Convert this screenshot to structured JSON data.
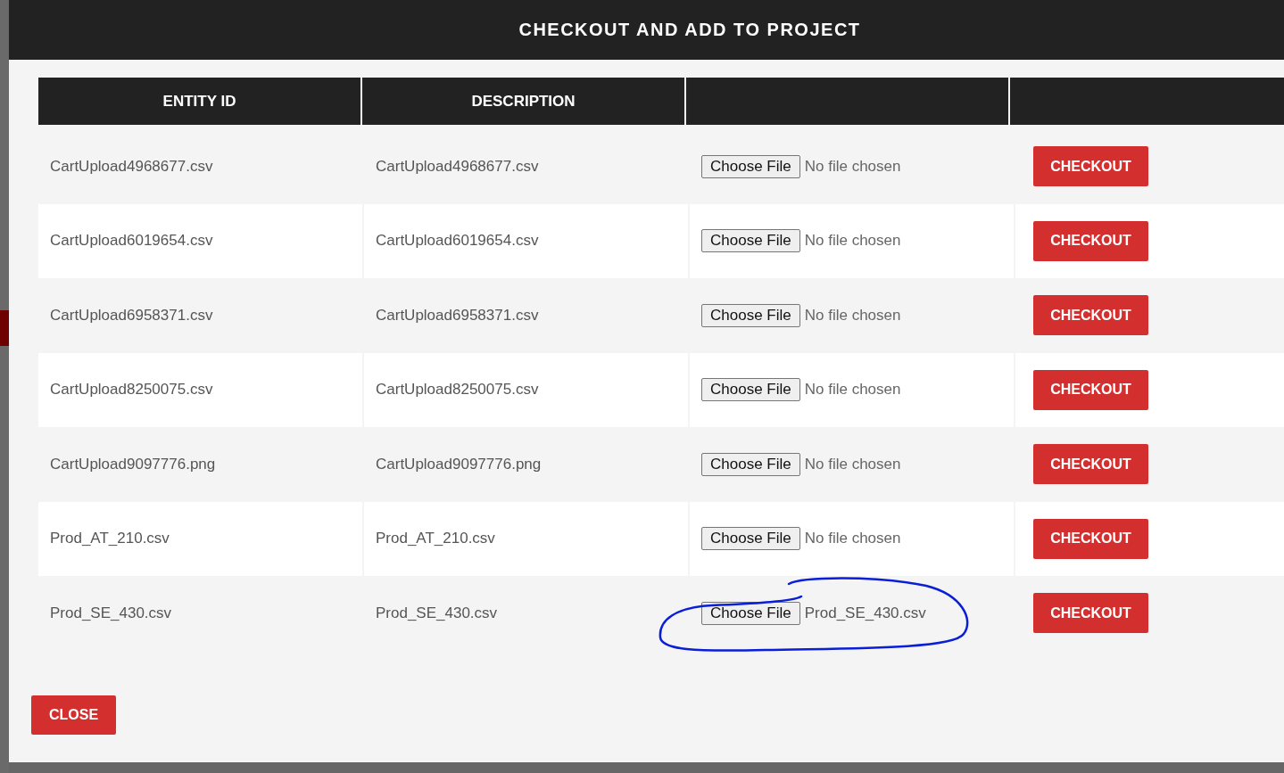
{
  "modal": {
    "title": "CHECKOUT AND ADD TO PROJECT"
  },
  "table": {
    "columns": [
      "ENTITY ID",
      "DESCRIPTION"
    ],
    "rows": [
      {
        "entity_id": "CartUpload4968677.csv",
        "description": "CartUpload4968677.csv",
        "file_button": "Choose File",
        "file_status": "No file chosen",
        "file_chosen": false,
        "checkout": "CHECKOUT",
        "circled": false
      },
      {
        "entity_id": "CartUpload6019654.csv",
        "description": "CartUpload6019654.csv",
        "file_button": "Choose File",
        "file_status": "No file chosen",
        "file_chosen": false,
        "checkout": "CHECKOUT",
        "circled": false
      },
      {
        "entity_id": "CartUpload6958371.csv",
        "description": "CartUpload6958371.csv",
        "file_button": "Choose File",
        "file_status": "No file chosen",
        "file_chosen": false,
        "checkout": "CHECKOUT",
        "circled": false
      },
      {
        "entity_id": "CartUpload8250075.csv",
        "description": "CartUpload8250075.csv",
        "file_button": "Choose File",
        "file_status": "No file chosen",
        "file_chosen": false,
        "checkout": "CHECKOUT",
        "circled": false
      },
      {
        "entity_id": "CartUpload9097776.png",
        "description": "CartUpload9097776.png",
        "file_button": "Choose File",
        "file_status": "No file chosen",
        "file_chosen": false,
        "checkout": "CHECKOUT",
        "circled": false
      },
      {
        "entity_id": "Prod_AT_210.csv",
        "description": "Prod_AT_210.csv",
        "file_button": "Choose File",
        "file_status": "No file chosen",
        "file_chosen": false,
        "checkout": "CHECKOUT",
        "circled": false
      },
      {
        "entity_id": "Prod_SE_430.csv",
        "description": "Prod_SE_430.csv",
        "file_button": "Choose File",
        "file_status": "Prod_SE_430.csv",
        "file_chosen": true,
        "checkout": "CHECKOUT",
        "circled": true
      }
    ]
  },
  "footer": {
    "close_button": "CLOSE"
  }
}
